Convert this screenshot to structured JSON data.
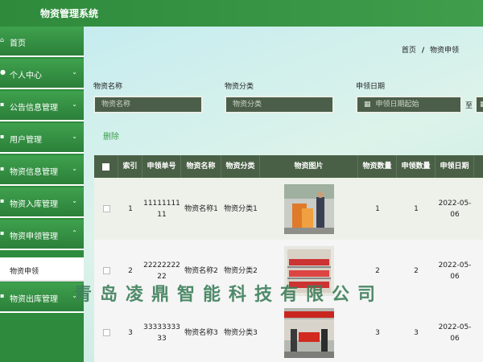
{
  "header": {
    "title": "物资管理系统"
  },
  "sidebar": {
    "items": [
      {
        "label": "首页",
        "has_children": false
      },
      {
        "label": "个人中心",
        "has_children": true
      },
      {
        "label": "公告信息管理",
        "has_children": true
      },
      {
        "label": "用户管理",
        "has_children": true
      },
      {
        "label": "物资信息管理",
        "has_children": true
      },
      {
        "label": "物资入库管理",
        "has_children": true
      },
      {
        "label": "物资申领管理",
        "has_children": true
      },
      {
        "label": "物资出库管理",
        "has_children": true
      }
    ],
    "sub_item": {
      "label": "物资申领"
    }
  },
  "breadcrumb": {
    "home": "首页",
    "separator": "/",
    "current": "物资申领"
  },
  "filters": {
    "name": {
      "label": "物资名称",
      "placeholder": "物资名称"
    },
    "category": {
      "label": "物资分类",
      "placeholder": "物资分类"
    },
    "date": {
      "label": "申领日期",
      "start_placeholder": "申领日期起始",
      "to": "至"
    }
  },
  "actions": {
    "delete_label": "删除"
  },
  "table": {
    "headers": [
      "索引",
      "申领单号",
      "物资名称",
      "物资分类",
      "物资图片",
      "物资数量",
      "申领数量",
      "申领日期"
    ],
    "rows": [
      {
        "index": "1",
        "order_no": "1111111111",
        "name": "物资名称1",
        "category": "物资分类1",
        "qty": "1",
        "apply_qty": "1",
        "date": "2022-05-06"
      },
      {
        "index": "2",
        "order_no": "2222222222",
        "name": "物资名称2",
        "category": "物资分类2",
        "qty": "2",
        "apply_qty": "2",
        "date": "2022-05-06"
      },
      {
        "index": "3",
        "order_no": "3333333333",
        "name": "物资名称3",
        "category": "物资分类3",
        "qty": "3",
        "apply_qty": "3",
        "date": "2022-05-06"
      }
    ]
  },
  "watermark": "青岛凌鼎智能科技有限公司",
  "colors": {
    "primary": "#3f9d4c",
    "table_header": "#4a6046",
    "input_bg": "#4b5e49"
  }
}
